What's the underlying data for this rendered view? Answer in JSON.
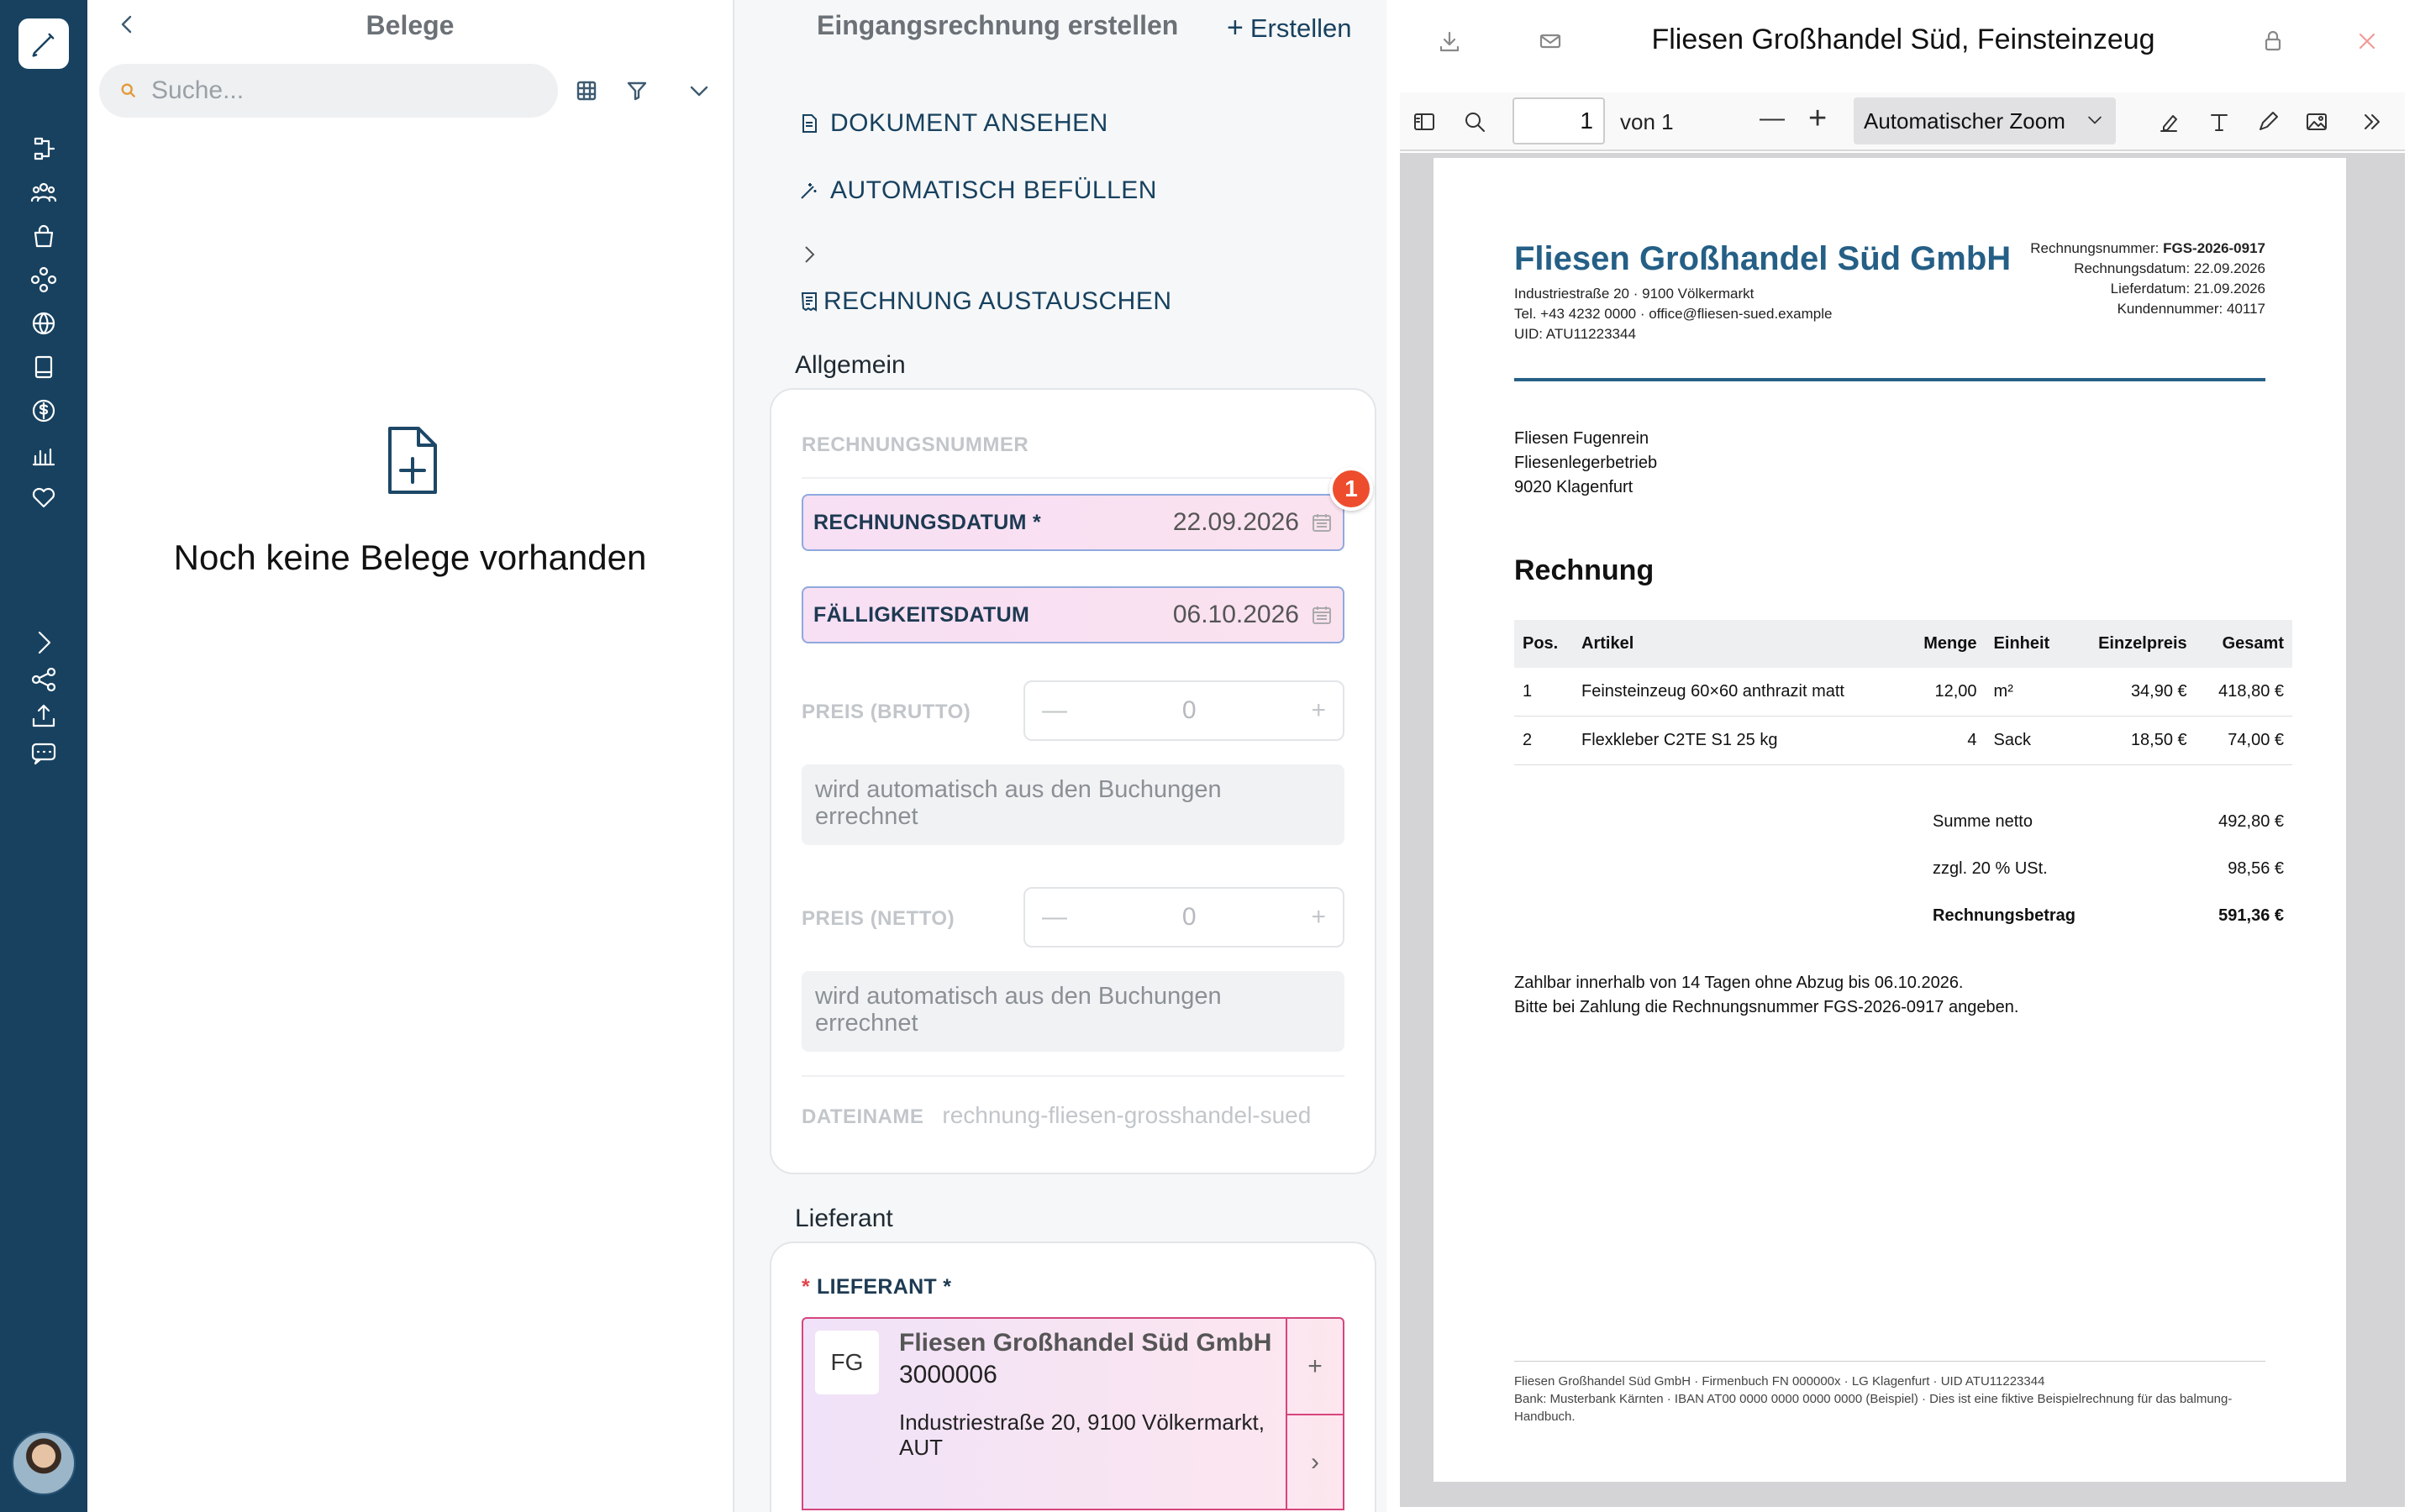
{
  "rail": {
    "items": [
      "pen-icon",
      "flow-icon",
      "people-icon",
      "bag-icon",
      "nodes-icon",
      "globe-icon",
      "book-icon",
      "dollar-icon",
      "bar-chart-icon",
      "heart-icon"
    ],
    "bottom": [
      "chevron-right-icon",
      "share-icon",
      "upload-icon",
      "chat-icon"
    ]
  },
  "belege": {
    "title": "Belege",
    "search_placeholder": "Suche...",
    "empty_text": "Noch keine Belege vorhanden"
  },
  "form": {
    "title": "Eingangsrechnung erstellen",
    "create_label": "Erstellen",
    "actions": {
      "view": "DOKUMENT ANSEHEN",
      "autofill": "AUTOMATISCH BEFÜLLEN",
      "replace": "RECHNUNG  AUSTAUSCHEN"
    },
    "section_general": "Allgemein",
    "invoice_number_label": "RECHNUNGSNUMMER",
    "invoice_date": {
      "label": "RECHNUNGSDATUM *",
      "value": "22.09.2026"
    },
    "due_date": {
      "label": "FÄLLIGKEITSDATUM",
      "value": "06.10.2026"
    },
    "badge": "1",
    "gross": {
      "label": "PREIS (BRUTTO)",
      "value": "0",
      "minus": "—",
      "plus": "+",
      "note": "wird automatisch aus den Buchungen errechnet"
    },
    "net": {
      "label": "PREIS (NETTO)",
      "value": "0",
      "minus": "—",
      "plus": "+",
      "note": "wird automatisch aus den Buchungen errechnet"
    },
    "filename": {
      "label": "DATEINAME",
      "value": "rechnung-fliesen-grosshandel-sued"
    },
    "section_supplier": "Lieferant",
    "supplier": {
      "required_mark": "*",
      "label": "LIEFERANT *",
      "initials": "FG",
      "name": "Fliesen Großhandel Süd GmbH",
      "number": "3000006",
      "address": "Industriestraße 20, 9100 Völkermarkt, AUT",
      "add": "+",
      "open": "›"
    }
  },
  "viewer": {
    "title": "Fliesen Großhandel Süd, Feinsteinzeug",
    "page_number": "1",
    "page_of": "von 1",
    "zoom": "Automatischer Zoom",
    "zoom_out": "—",
    "zoom_in": "+"
  },
  "invoice": {
    "company": "Fliesen Großhandel Süd GmbH",
    "company_info": [
      "Industriestraße 20 · 9100 Völkermarkt",
      "Tel. +43 4232 0000 · office@fliesen-sued.example",
      "UID: ATU11223344"
    ],
    "meta": [
      {
        "k": "Rechnungsnummer:",
        "v": "FGS-2026-0917"
      },
      {
        "k": "Rechnungsdatum:",
        "v": "22.09.2026"
      },
      {
        "k": "Lieferdatum:",
        "v": "21.09.2026"
      },
      {
        "k": "Kundennummer:",
        "v": "40117"
      }
    ],
    "recipient": [
      "Fliesen Fugenrein",
      "Fliesenlegerbetrieb",
      "9020 Klagenfurt"
    ],
    "heading": "Rechnung",
    "columns": [
      "Pos.",
      "Artikel",
      "Menge",
      "Einheit",
      "Einzelpreis",
      "Gesamt"
    ],
    "rows": [
      [
        "1",
        "Feinsteinzeug 60×60 anthrazit matt",
        "12,00",
        "m²",
        "34,90 €",
        "418,80 €"
      ],
      [
        "2",
        "Flexkleber C2TE S1 25 kg",
        "4",
        "Sack",
        "18,50 €",
        "74,00 €"
      ]
    ],
    "totals": [
      {
        "label": "Summe netto",
        "value": "492,80 €"
      },
      {
        "label": "zzgl. 20 % USt.",
        "value": "98,56 €"
      },
      {
        "label": "Rechnungsbetrag",
        "value": "591,36 €"
      }
    ],
    "note": [
      "Zahlbar innerhalb von 14 Tagen ohne Abzug bis 06.10.2026.",
      "Bitte bei Zahlung die Rechnungsnummer FGS-2026-0917 angeben."
    ],
    "footer": [
      "Fliesen Großhandel Süd GmbH · Firmenbuch FN 000000x · LG Klagenfurt · UID ATU11223344",
      "Bank: Musterbank Kärnten · IBAN AT00 0000 0000 0000 0000 (Beispiel) · Dies ist eine fiktive Beispielrechnung für das balmung-Handbuch."
    ]
  }
}
